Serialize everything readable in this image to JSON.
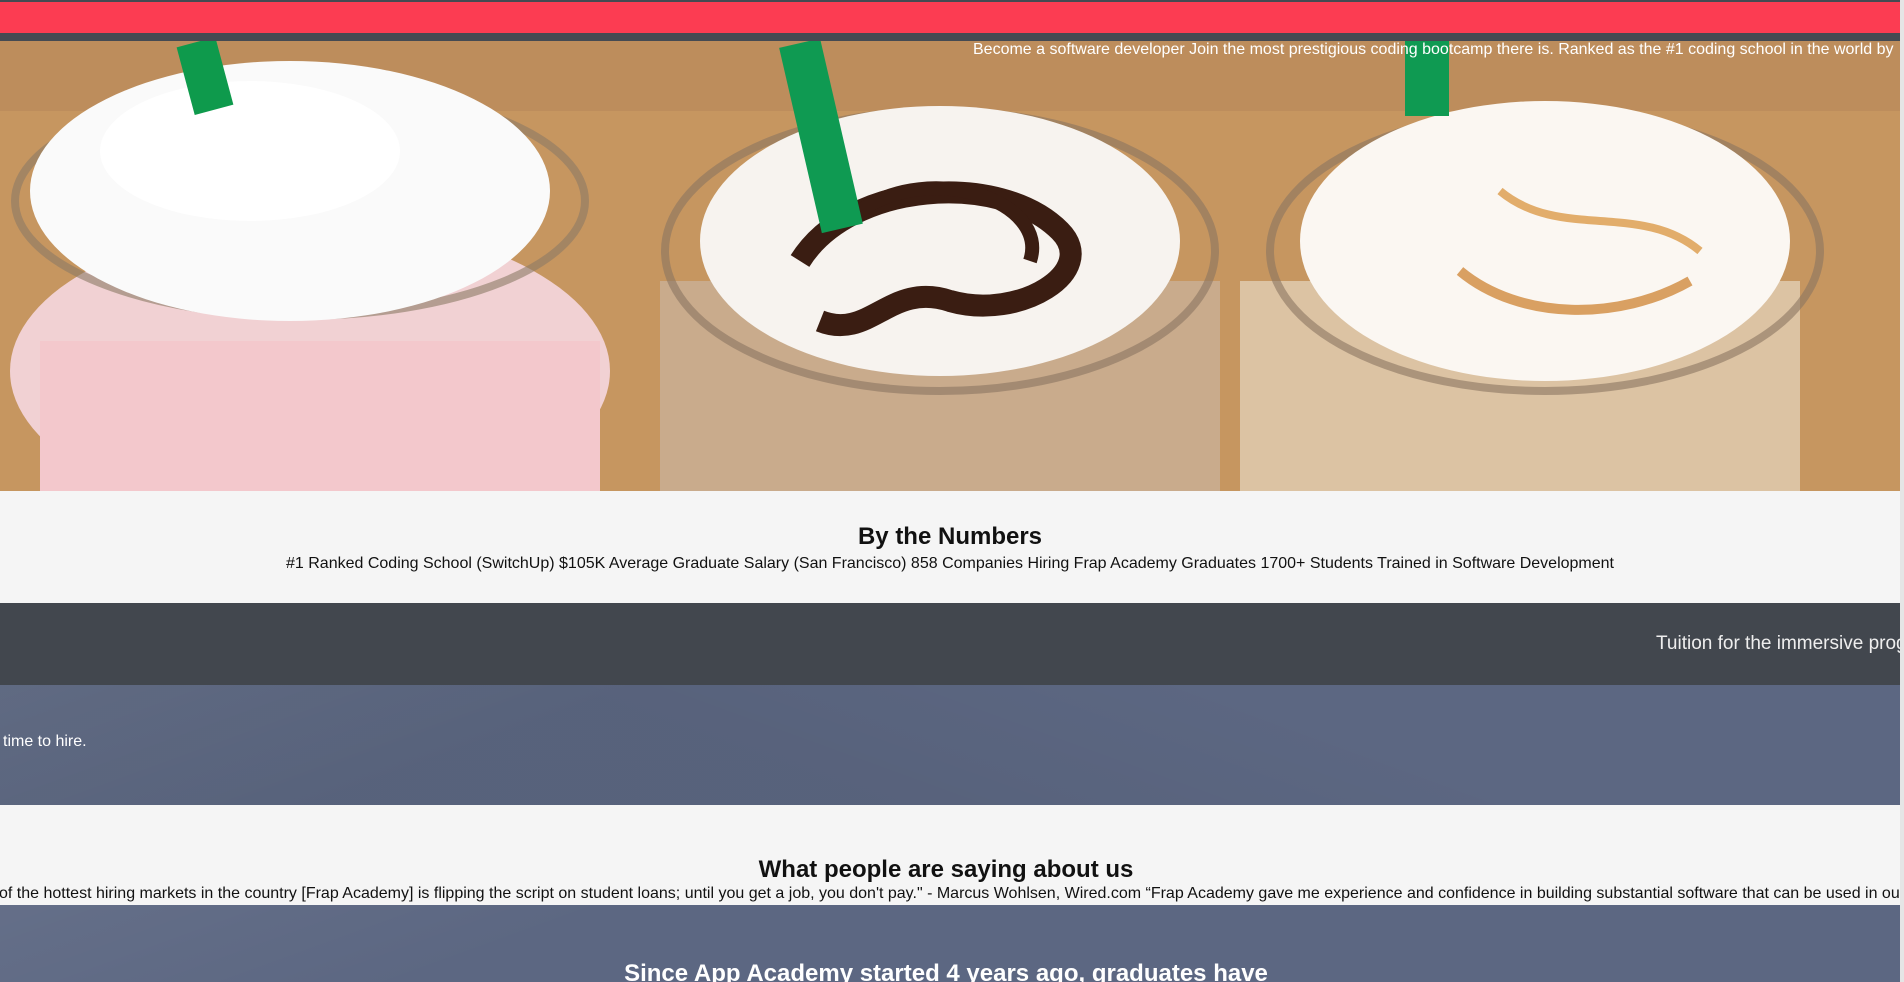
{
  "hero": {
    "tagline": "Become a software developer Join the most prestigious coding bootcamp there is. Ranked as the #1 coding school in the world by ",
    "image_alt": "frappuccinos-with-whipped-cream-photo"
  },
  "numbers": {
    "heading": "By the Numbers",
    "text": "#1 Ranked Coding School (SwitchUp) $105K Average Graduate Salary (San Francisco) 858 Companies Hiring Frap Academy Graduates 1700+ Students Trained in Software Development"
  },
  "tuition": {
    "text": "Tuition for the immersive prog"
  },
  "hire": {
    "text": " time to hire."
  },
  "testimonials": {
    "heading": "What people are saying about us",
    "text": "of the hottest hiring markets in the country [Frap Academy] is flipping the script on student loans; until you get a job, you don't pay.\" - Marcus Wohlsen, Wired.com “Frap Academy gave me experience and confidence in building substantial software that can be used in our"
  },
  "since": {
    "heading": "Since App Academy started 4 years ago, graduates have"
  },
  "colors": {
    "accent_red": "#fc3c52",
    "dark_band": "#42474e",
    "slate_band": "#5c6782"
  }
}
